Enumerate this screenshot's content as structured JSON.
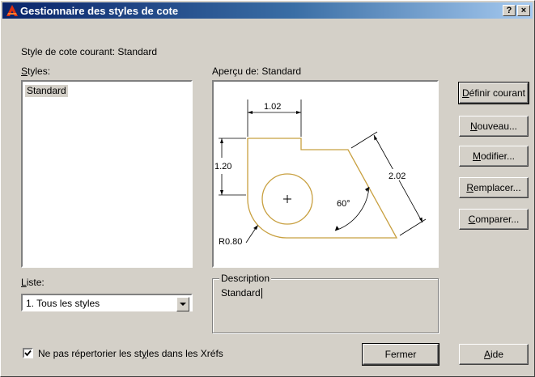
{
  "window": {
    "title": "Gestionnaire des styles de cote",
    "help_glyph": "?",
    "close_glyph": "×"
  },
  "current_style": {
    "label": "Style de cote courant: Standard"
  },
  "styles": {
    "label_accel": "S",
    "label_rest": "tyles:",
    "items": [
      "Standard"
    ]
  },
  "preview": {
    "label": "Aperçu de: Standard",
    "dims": {
      "top": "1.02",
      "left": "1.20",
      "right": "2.02",
      "angle": "60°",
      "radius": "R0.80"
    }
  },
  "buttons": {
    "set_current": {
      "accel": "D",
      "rest": "éfinir courant"
    },
    "new": {
      "accel": "N",
      "rest": "ouveau..."
    },
    "modify": {
      "accel": "M",
      "rest": "odifier..."
    },
    "override": {
      "accel": "R",
      "rest": "emplacer..."
    },
    "compare": {
      "accel": "C",
      "rest": "omparer..."
    },
    "close": {
      "label": "Fermer"
    },
    "help": {
      "accel": "A",
      "rest": "ide"
    }
  },
  "list_filter": {
    "label_accel": "L",
    "label_rest": "iste:",
    "selected": "1. Tous les styles"
  },
  "description": {
    "legend": "Description",
    "text": "Standard"
  },
  "xref_option": {
    "checked": true,
    "label_pre": "Ne pas répertorier les st",
    "label_accel": "y",
    "label_post": "les dans les Xréfs"
  },
  "colors": {
    "title_start": "#0a246a",
    "title_end": "#a6caf0",
    "dialog_bg": "#d4d0c8",
    "geometry": "#c8a040",
    "dim_lines": "#000000"
  }
}
